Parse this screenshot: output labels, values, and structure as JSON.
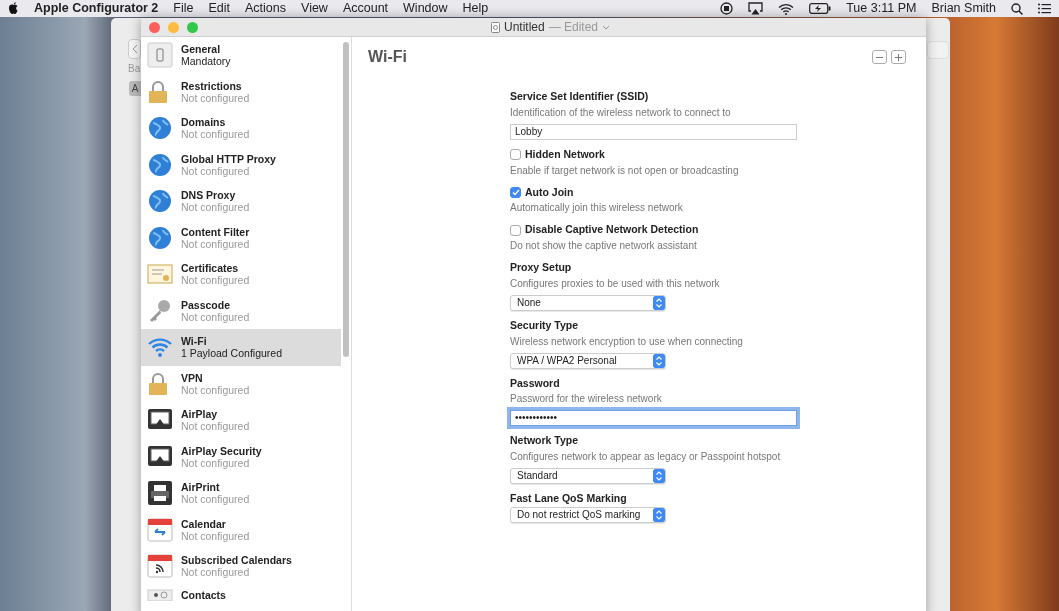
{
  "menubar": {
    "app": "Apple Configurator 2",
    "menus": [
      "File",
      "Edit",
      "Actions",
      "View",
      "Account",
      "Window",
      "Help"
    ],
    "clock": "Tue 3:11 PM",
    "user": "Brian Smith"
  },
  "back_window": {
    "label": "Ba",
    "button": "A"
  },
  "window": {
    "title": "Untitled",
    "edited": "— Edited",
    "sidebar": [
      {
        "kind": "device",
        "title": "General",
        "subtitle": "Mandatory",
        "configured": true,
        "selected": false
      },
      {
        "kind": "padlock",
        "title": "Restrictions",
        "subtitle": "Not configured",
        "configured": false,
        "selected": false
      },
      {
        "kind": "globe",
        "title": "Domains",
        "subtitle": "Not configured",
        "configured": false,
        "selected": false
      },
      {
        "kind": "globe",
        "title": "Global HTTP Proxy",
        "subtitle": "Not configured",
        "configured": false,
        "selected": false
      },
      {
        "kind": "globe",
        "title": "DNS Proxy",
        "subtitle": "Not configured",
        "configured": false,
        "selected": false
      },
      {
        "kind": "globe",
        "title": "Content Filter",
        "subtitle": "Not configured",
        "configured": false,
        "selected": false
      },
      {
        "kind": "certificate",
        "title": "Certificates",
        "subtitle": "Not configured",
        "configured": false,
        "selected": false
      },
      {
        "kind": "key",
        "title": "Passcode",
        "subtitle": "Not configured",
        "configured": false,
        "selected": false
      },
      {
        "kind": "wifi",
        "title": "Wi-Fi",
        "subtitle": "1 Payload Configured",
        "configured": true,
        "selected": true
      },
      {
        "kind": "padlock",
        "title": "VPN",
        "subtitle": "Not configured",
        "configured": false,
        "selected": false
      },
      {
        "kind": "screen",
        "title": "AirPlay",
        "subtitle": "Not configured",
        "configured": false,
        "selected": false
      },
      {
        "kind": "screen",
        "title": "AirPlay Security",
        "subtitle": "Not configured",
        "configured": false,
        "selected": false
      },
      {
        "kind": "printer",
        "title": "AirPrint",
        "subtitle": "Not configured",
        "configured": false,
        "selected": false
      },
      {
        "kind": "calendar",
        "title": "Calendar",
        "subtitle": "Not configured",
        "configured": false,
        "selected": false
      },
      {
        "kind": "rss",
        "title": "Subscribed Calendars",
        "subtitle": "Not configured",
        "configured": false,
        "selected": false
      },
      {
        "kind": "contacts",
        "title": "Contacts",
        "selected": false
      }
    ],
    "panel": {
      "title": "Wi-Fi",
      "fields": [
        {
          "kind": "text",
          "label": "Service Set Identifier (SSID)",
          "description": "Identification of the wireless network to connect to",
          "value": "Lobby"
        },
        {
          "kind": "checkbox",
          "label": "Hidden Network",
          "checked": false,
          "description": "Enable if target network is not open or broadcasting"
        },
        {
          "kind": "checkbox",
          "label": "Auto Join",
          "checked": true,
          "description": "Automatically join this wireless network"
        },
        {
          "kind": "checkbox",
          "label": "Disable Captive Network Detection",
          "checked": false,
          "description": "Do not show the captive network assistant"
        },
        {
          "kind": "select",
          "label": "Proxy Setup",
          "description": "Configures proxies to be used with this network",
          "value": "None"
        },
        {
          "kind": "select",
          "label": "Security Type",
          "description": "Wireless network encryption to use when connecting",
          "value": "WPA / WPA2 Personal"
        },
        {
          "kind": "password",
          "label": "Password",
          "description": "Password for the wireless network",
          "value": "••••••••••••",
          "focused": true
        },
        {
          "kind": "select",
          "label": "Network Type",
          "description": "Configures network to appear as legacy or Passpoint hotspot",
          "value": "Standard"
        },
        {
          "kind": "select",
          "label": "Fast Lane QoS Marking",
          "value": "Do not restrict QoS marking"
        }
      ]
    }
  }
}
